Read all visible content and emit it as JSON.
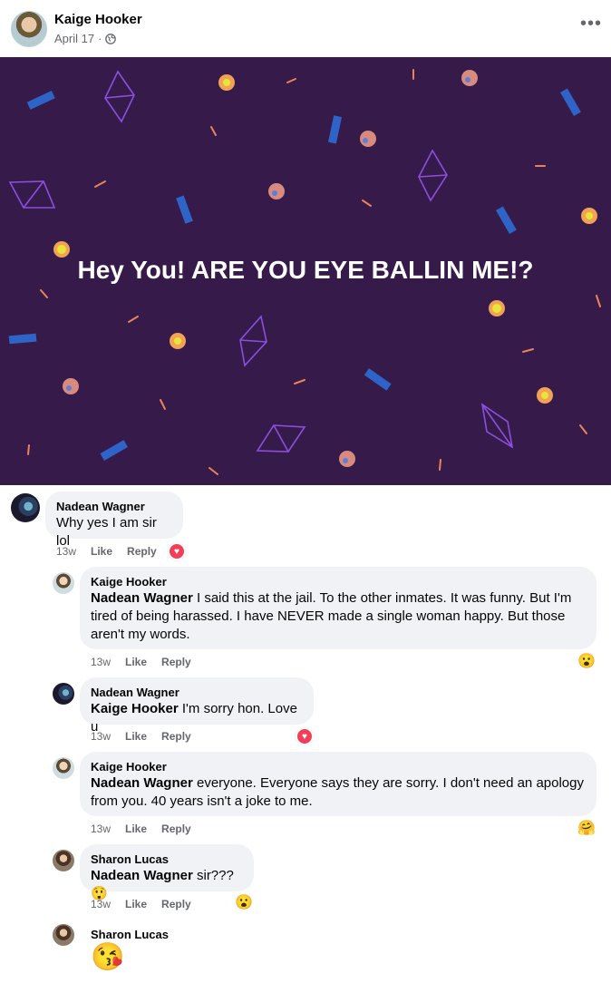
{
  "post": {
    "author": "Kaige Hooker",
    "date": "April 17",
    "separator": "·",
    "more_label": "•••",
    "banner_text": "Hey You! ARE YOU EYE BALLIN ME!?"
  },
  "actions": {
    "like": "Like",
    "reply": "Reply"
  },
  "comments": [
    {
      "name": "Nadean Wagner",
      "text": "Why yes I am sir lol",
      "time": "13w",
      "reaction": "heart"
    },
    {
      "name": "Kaige Hooker",
      "mention": "Nadean Wagner",
      "text": " I said this at the jail. To the other inmates. It was funny. But I'm tired of being harassed. I have NEVER made a single woman happy. But those aren't my words.",
      "time": "13w",
      "reaction": "😮"
    },
    {
      "name": "Nadean Wagner",
      "mention": "Kaige Hooker",
      "text": " I'm sorry hon. Love u",
      "time": "13w",
      "reaction": "heart"
    },
    {
      "name": "Kaige Hooker",
      "mention": "Nadean Wagner",
      "text": " everyone. Everyone says they are sorry. I don't need an apology from you. 40 years isn't a joke to me.",
      "time": "13w",
      "reaction": "🤗"
    },
    {
      "name": "Sharon Lucas",
      "mention": "Nadean Wagner",
      "text": " sir???😲",
      "time": "13w",
      "reaction": "😮"
    },
    {
      "name": "Sharon Lucas",
      "text": "😘"
    }
  ]
}
